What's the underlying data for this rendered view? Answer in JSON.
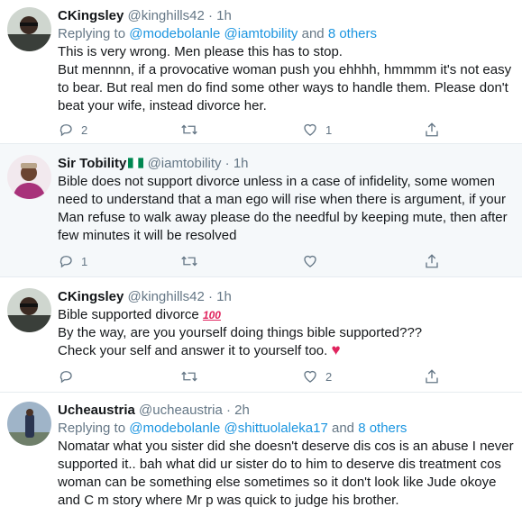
{
  "tweets": [
    {
      "name": "CKingsley",
      "handle": "@kinghills42",
      "dot": "·",
      "time": "1h",
      "replying_prefix": "Replying to ",
      "replying_users": "@modebolanle @iamtobility",
      "replying_and": " and ",
      "replying_others": "8 others",
      "lines": [
        "This is very wrong. Men please this has to stop.",
        "But mennnn, if a provocative woman push you ehhhh, hmmmm it's not easy",
        "to bear. But real men do find some other ways to handle them. Please don't",
        "beat your wife, instead divorce her."
      ],
      "reply_count": "2",
      "retweet_count": "",
      "like_count": "1"
    },
    {
      "name": "Sir Tobility",
      "handle": "@iamtobility",
      "dot": "·",
      "time": "1h",
      "lines": [
        "Bible does not support divorce unless in a case of infidelity, some women",
        "need to understand that a man ego will rise when there is argument, if your",
        "Man refuse to walk away please do the needful by keeping mute, then after",
        "few minutes it will be resolved"
      ],
      "reply_count": "1",
      "retweet_count": "",
      "like_count": ""
    },
    {
      "name": "CKingsley",
      "handle": "@kinghills42",
      "dot": "·",
      "time": "1h",
      "line1": "Bible supported divorce",
      "emoji_100": "100",
      "line2": "By the way, are you yourself doing things bible supported???",
      "line3": "Check your self and answer it to yourself too.",
      "heart_emoji": "♥",
      "reply_count": "",
      "retweet_count": "",
      "like_count": "2"
    },
    {
      "name": "Ucheaustria",
      "handle": "@ucheaustria",
      "dot": "·",
      "time": "2h",
      "replying_prefix": "Replying to ",
      "replying_users": "@modebolanle @shittuolaleka17",
      "replying_and": " and ",
      "replying_others": "8 others",
      "lines": [
        "Nomatar what you sister did she doesn't deserve dis cos is an abuse I never",
        "supported it.. bah what did ur sister do to him to deserve dis treatment cos",
        "woman can be something else sometimes so it don't look like Jude okoye",
        "and C m story where Mr p was quick to judge his brother."
      ]
    }
  ],
  "colors": {
    "link": "#1b95e0",
    "secondary": "#657786",
    "highlight_bg": "#f5f8fa",
    "heart": "#e0245e"
  },
  "icons": [
    "reply-icon",
    "retweet-icon",
    "like-icon",
    "share-icon"
  ]
}
